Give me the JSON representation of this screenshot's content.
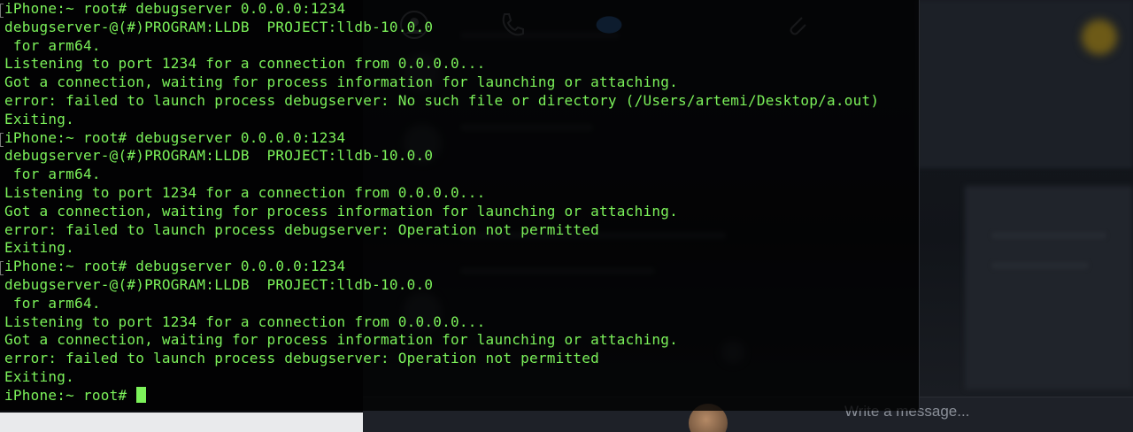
{
  "terminal": {
    "lines": [
      "iPhone:~ root# debugserver 0.0.0.0:1234",
      "debugserver-@(#)PROGRAM:LLDB  PROJECT:lldb-10.0.0",
      " for arm64.",
      "Listening to port 1234 for a connection from 0.0.0.0...",
      "Got a connection, waiting for process information for launching or attaching.",
      "error: failed to launch process debugserver: No such file or directory (/Users/artemi/Desktop/a.out)",
      "Exiting.",
      "iPhone:~ root# debugserver 0.0.0.0:1234",
      "debugserver-@(#)PROGRAM:LLDB  PROJECT:lldb-10.0.0",
      " for arm64.",
      "Listening to port 1234 for a connection from 0.0.0.0...",
      "Got a connection, waiting for process information for launching or attaching.",
      "error: failed to launch process debugserver: Operation not permitted",
      "Exiting.",
      "iPhone:~ root# debugserver 0.0.0.0:1234",
      "debugserver-@(#)PROGRAM:LLDB  PROJECT:lldb-10.0.0",
      " for arm64.",
      "Listening to port 1234 for a connection from 0.0.0.0...",
      "Got a connection, waiting for process information for launching or attaching.",
      "error: failed to launch process debugserver: Operation not permitted",
      "Exiting."
    ],
    "prompt": "iPhone:~ root# ",
    "text_color": "#7cf25a",
    "background_color": "#000000"
  },
  "chat": {
    "message_placeholder": "Write a message...",
    "icons": [
      "profile-icon",
      "phone-icon",
      "chat-bubble-icon",
      "avatar",
      "attach-icon"
    ]
  }
}
